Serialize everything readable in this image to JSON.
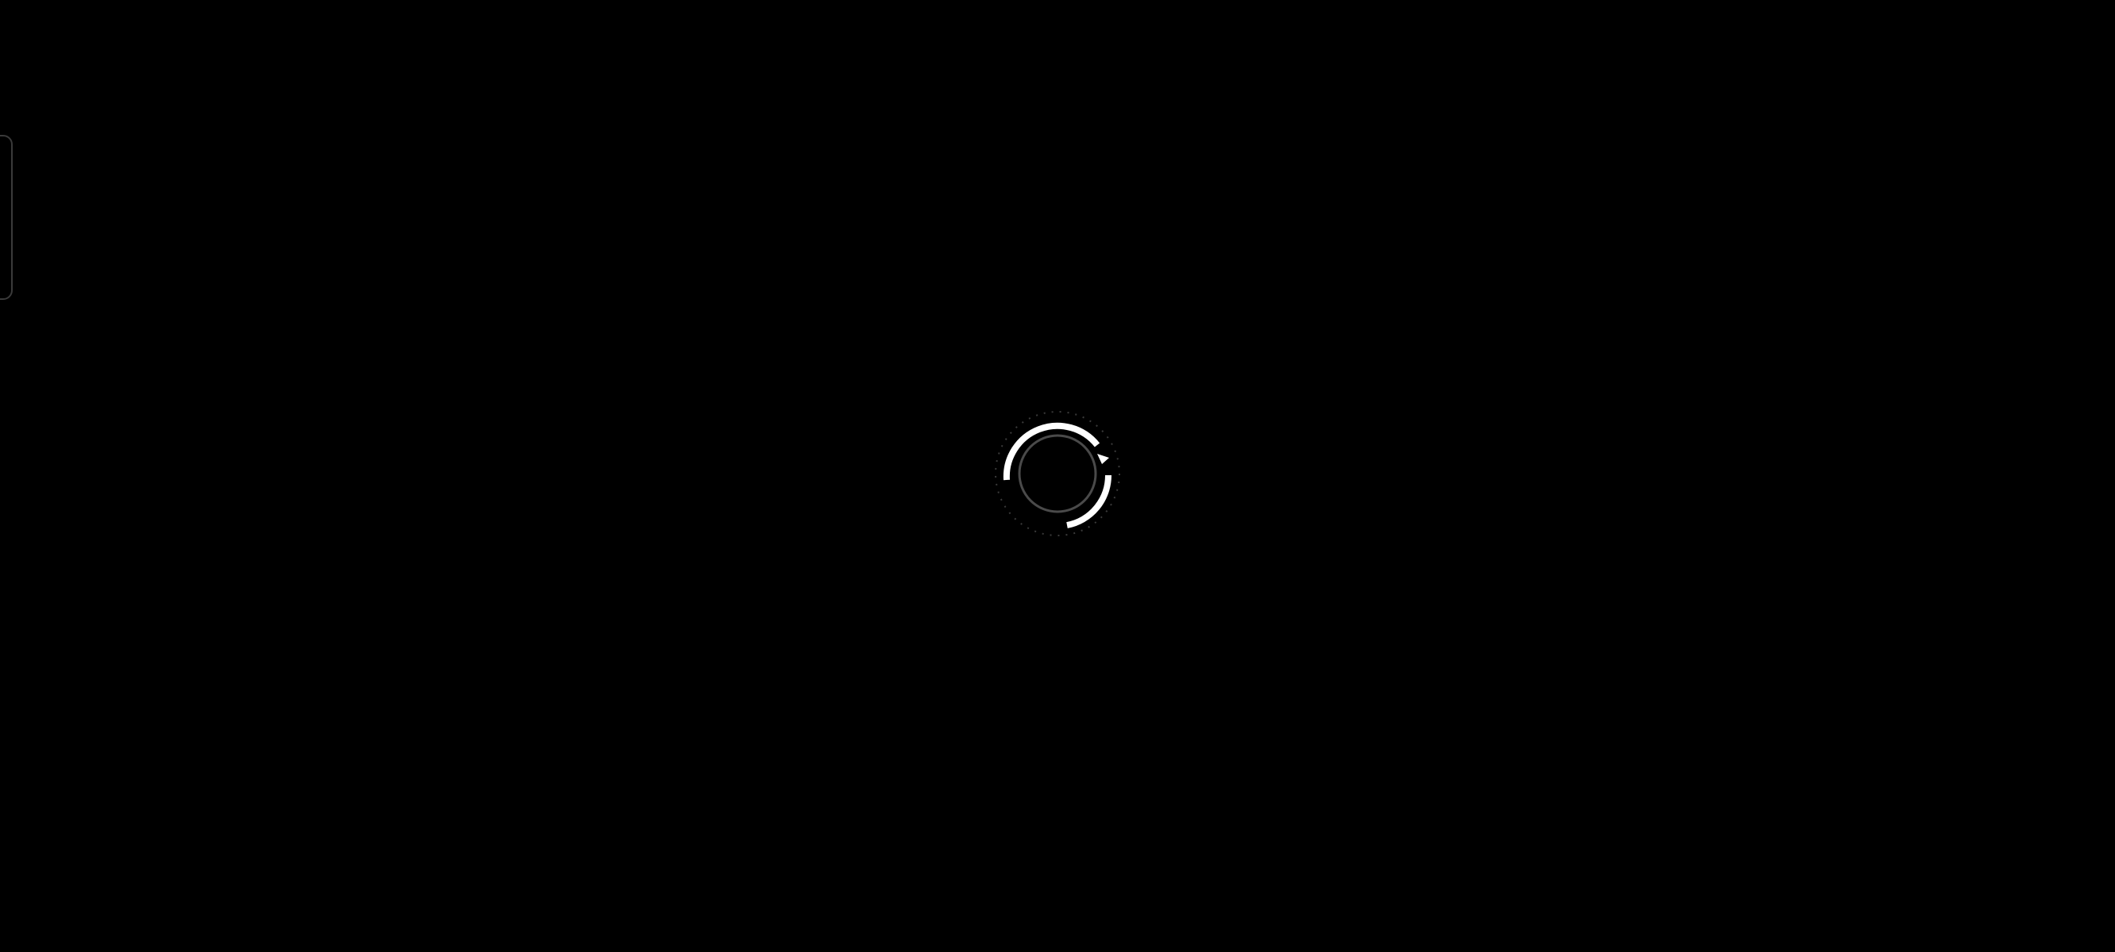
{
  "screen": {
    "background_color": "#000000",
    "state": "loading"
  },
  "edge_handle": {
    "icon": "side-panel-handle",
    "border_color": "#3a3a3a"
  },
  "loading_indicator": {
    "icon": "loading-spinner-icon",
    "arc_color": "#ffffff",
    "inner_ring_color": "#4a4a4a",
    "dotted_ring_color": "#3a3a3a"
  }
}
